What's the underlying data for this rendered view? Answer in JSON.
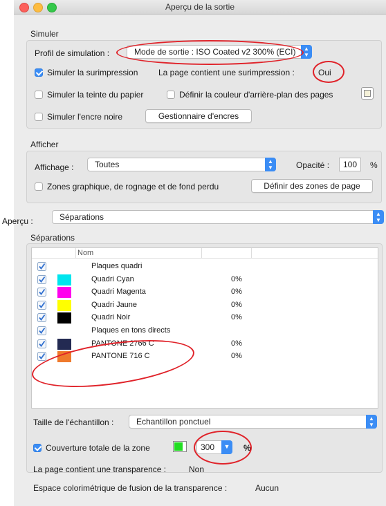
{
  "window": {
    "title": "Aperçu de la sortie"
  },
  "simuler": {
    "group_label": "Simuler",
    "profil_label": "Profil de simulation :",
    "profil_value": "Mode de sortie : ISO Coated v2 300% (ECI)",
    "surimpression_label": "Simuler la surimpression",
    "page_surimpression_label": "La page contient une surimpression :",
    "page_surimpression_value": "Oui",
    "teinte_label": "Simuler la teinte du papier",
    "fond_label": "Définir la couleur d'arrière-plan des pages",
    "encre_noire_label": "Simuler l'encre noire",
    "gestionnaire_button": "Gestionnaire d'encres"
  },
  "afficher": {
    "group_label": "Afficher",
    "affichage_label": "Affichage :",
    "affichage_value": "Toutes",
    "opacite_label": "Opacité :",
    "opacite_value": "100",
    "opacite_unit": "%",
    "zones_label": "Zones graphique, de rognage et de fond perdu",
    "definir_zones_button": "Définir des zones de page"
  },
  "apercu": {
    "label": "Aperçu :",
    "value": "Séparations"
  },
  "separations": {
    "group_label": "Séparations",
    "column_nom": "Nom",
    "rows": [
      {
        "name": "Plaques quadri",
        "pct": "",
        "color": "",
        "checked": true
      },
      {
        "name": "Quadri Cyan",
        "pct": "0%",
        "color": "#00e5ee",
        "checked": true
      },
      {
        "name": "Quadri Magenta",
        "pct": "0%",
        "color": "#ff00ee",
        "checked": true
      },
      {
        "name": "Quadri Jaune",
        "pct": "0%",
        "color": "#ffff00",
        "checked": true
      },
      {
        "name": "Quadri Noir",
        "pct": "0%",
        "color": "#000000",
        "checked": true
      },
      {
        "name": "Plaques en tons directs",
        "pct": "",
        "color": "",
        "checked": true
      },
      {
        "name": "PANTONE 2766 C",
        "pct": "0%",
        "color": "#232a52",
        "checked": true
      },
      {
        "name": "PANTONE 716 C",
        "pct": "0%",
        "color": "#ef7a2c",
        "checked": true
      }
    ]
  },
  "echantillon": {
    "label": "Taille de l'échantillon :",
    "value": "Echantillon ponctuel"
  },
  "couverture": {
    "label": "Couverture totale de la zone",
    "value": "300",
    "unit": "%",
    "swatch_color": "#22dd22"
  },
  "transparence": {
    "label": "La page contient une transparence :",
    "value": "Non",
    "espace_label": "Espace colorimétrique de fusion de la transparence :",
    "espace_value": "Aucun"
  }
}
